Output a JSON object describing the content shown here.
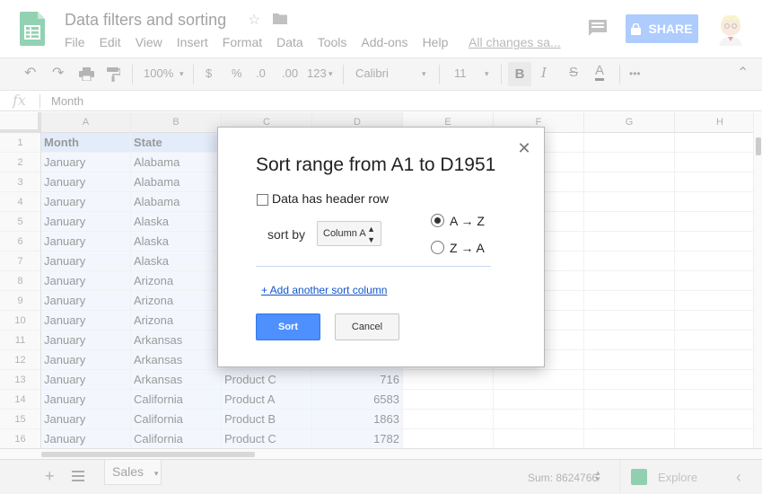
{
  "app": {
    "title": "Data filters and sorting",
    "menu": [
      "File",
      "Edit",
      "View",
      "Insert",
      "Format",
      "Data",
      "Tools",
      "Add-ons",
      "Help"
    ],
    "save_status": "All changes sa...",
    "share_label": "SHARE"
  },
  "toolbar": {
    "zoom": "100%",
    "currency": "$",
    "percent": "%",
    "decrease_decimal": ".0",
    "increase_decimal": ".00",
    "number_format": "123",
    "font": "Calibri",
    "font_size": "11",
    "bold": "B",
    "italic": "I",
    "strikethrough": "S",
    "text_color": "A",
    "more": "•••"
  },
  "formula_bar": {
    "fx": "fx",
    "value": "Month"
  },
  "grid": {
    "columns": [
      "A",
      "B",
      "C",
      "D",
      "E",
      "F",
      "G",
      "H"
    ],
    "rows": [
      {
        "n": "1",
        "a": "Month",
        "b": "State",
        "c": "",
        "d": ""
      },
      {
        "n": "2",
        "a": "January",
        "b": "Alabama",
        "c": "",
        "d": ""
      },
      {
        "n": "3",
        "a": "January",
        "b": "Alabama",
        "c": "",
        "d": ""
      },
      {
        "n": "4",
        "a": "January",
        "b": "Alabama",
        "c": "",
        "d": ""
      },
      {
        "n": "5",
        "a": "January",
        "b": "Alaska",
        "c": "",
        "d": ""
      },
      {
        "n": "6",
        "a": "January",
        "b": "Alaska",
        "c": "",
        "d": ""
      },
      {
        "n": "7",
        "a": "January",
        "b": "Alaska",
        "c": "",
        "d": ""
      },
      {
        "n": "8",
        "a": "January",
        "b": "Arizona",
        "c": "",
        "d": ""
      },
      {
        "n": "9",
        "a": "January",
        "b": "Arizona",
        "c": "",
        "d": ""
      },
      {
        "n": "10",
        "a": "January",
        "b": "Arizona",
        "c": "",
        "d": ""
      },
      {
        "n": "11",
        "a": "January",
        "b": "Arkansas",
        "c": "",
        "d": ""
      },
      {
        "n": "12",
        "a": "January",
        "b": "Arkansas",
        "c": "",
        "d": ""
      },
      {
        "n": "13",
        "a": "January",
        "b": "Arkansas",
        "c": "Product C",
        "d": "716"
      },
      {
        "n": "14",
        "a": "January",
        "b": "California",
        "c": "Product A",
        "d": "6583"
      },
      {
        "n": "15",
        "a": "January",
        "b": "California",
        "c": "Product B",
        "d": "1863"
      },
      {
        "n": "16",
        "a": "January",
        "b": "California",
        "c": "Product C",
        "d": "1782"
      }
    ]
  },
  "bottom": {
    "add_sheet": "+",
    "sheet_name": "Sales",
    "sum": "Sum: 8624766",
    "explore": "Explore"
  },
  "dialog": {
    "title": "Sort range from A1 to D1951",
    "header_row_label": "Data has header row",
    "sort_by_label": "sort by",
    "column_value": "Column A",
    "option_az": "A → Z",
    "option_za": "Z → A",
    "add_column_link": "+ Add another sort column",
    "sort_button": "Sort",
    "cancel_button": "Cancel"
  },
  "colors": {
    "accent": "#4d90fe",
    "link": "#1155cc",
    "logo_green": "#0f9d58",
    "selection": "#e6eefb"
  }
}
